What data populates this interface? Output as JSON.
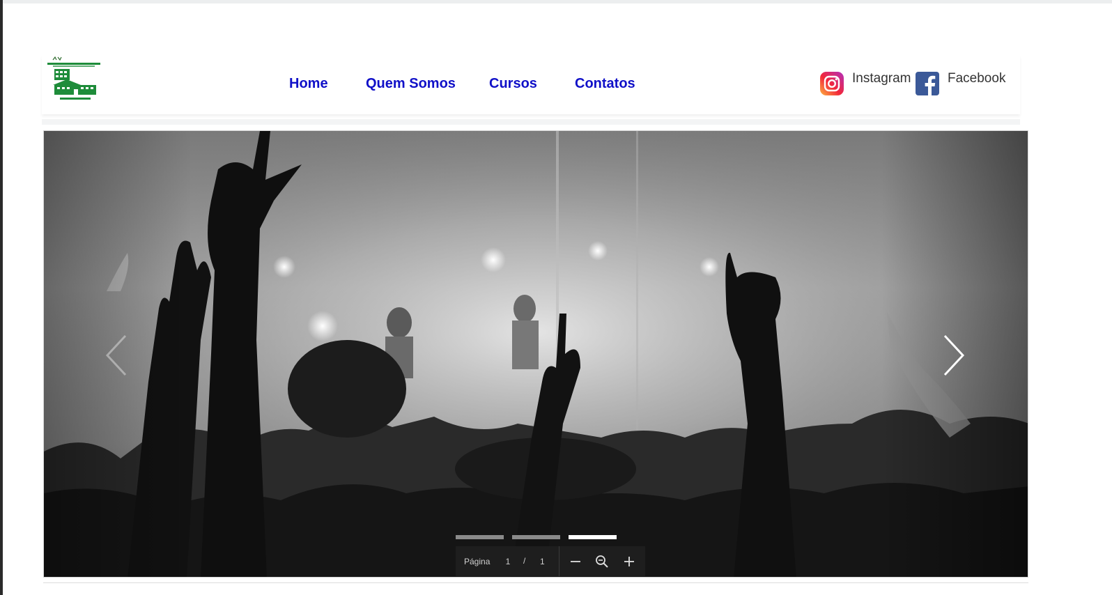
{
  "header": {
    "logo_name": "school-logo",
    "nav": [
      {
        "label": "Home"
      },
      {
        "label": "Quem Somos"
      },
      {
        "label": "Cursos"
      },
      {
        "label": "Contatos"
      }
    ],
    "social": [
      {
        "label": "Instagram",
        "icon": "instagram-icon"
      },
      {
        "label": "Facebook",
        "icon": "facebook-icon"
      }
    ],
    "nav_color": "#1010c8"
  },
  "slider": {
    "total_slides": 3,
    "active_slide": 3,
    "prev_icon": "chevron-left-icon",
    "next_icon": "chevron-right-icon"
  },
  "viewer": {
    "page_label": "Página",
    "current_page": "1",
    "separator": "/",
    "total_pages": "1",
    "zoom_out_icon": "minus-icon",
    "zoom_icon": "zoom-icon",
    "zoom_in_icon": "plus-icon"
  }
}
